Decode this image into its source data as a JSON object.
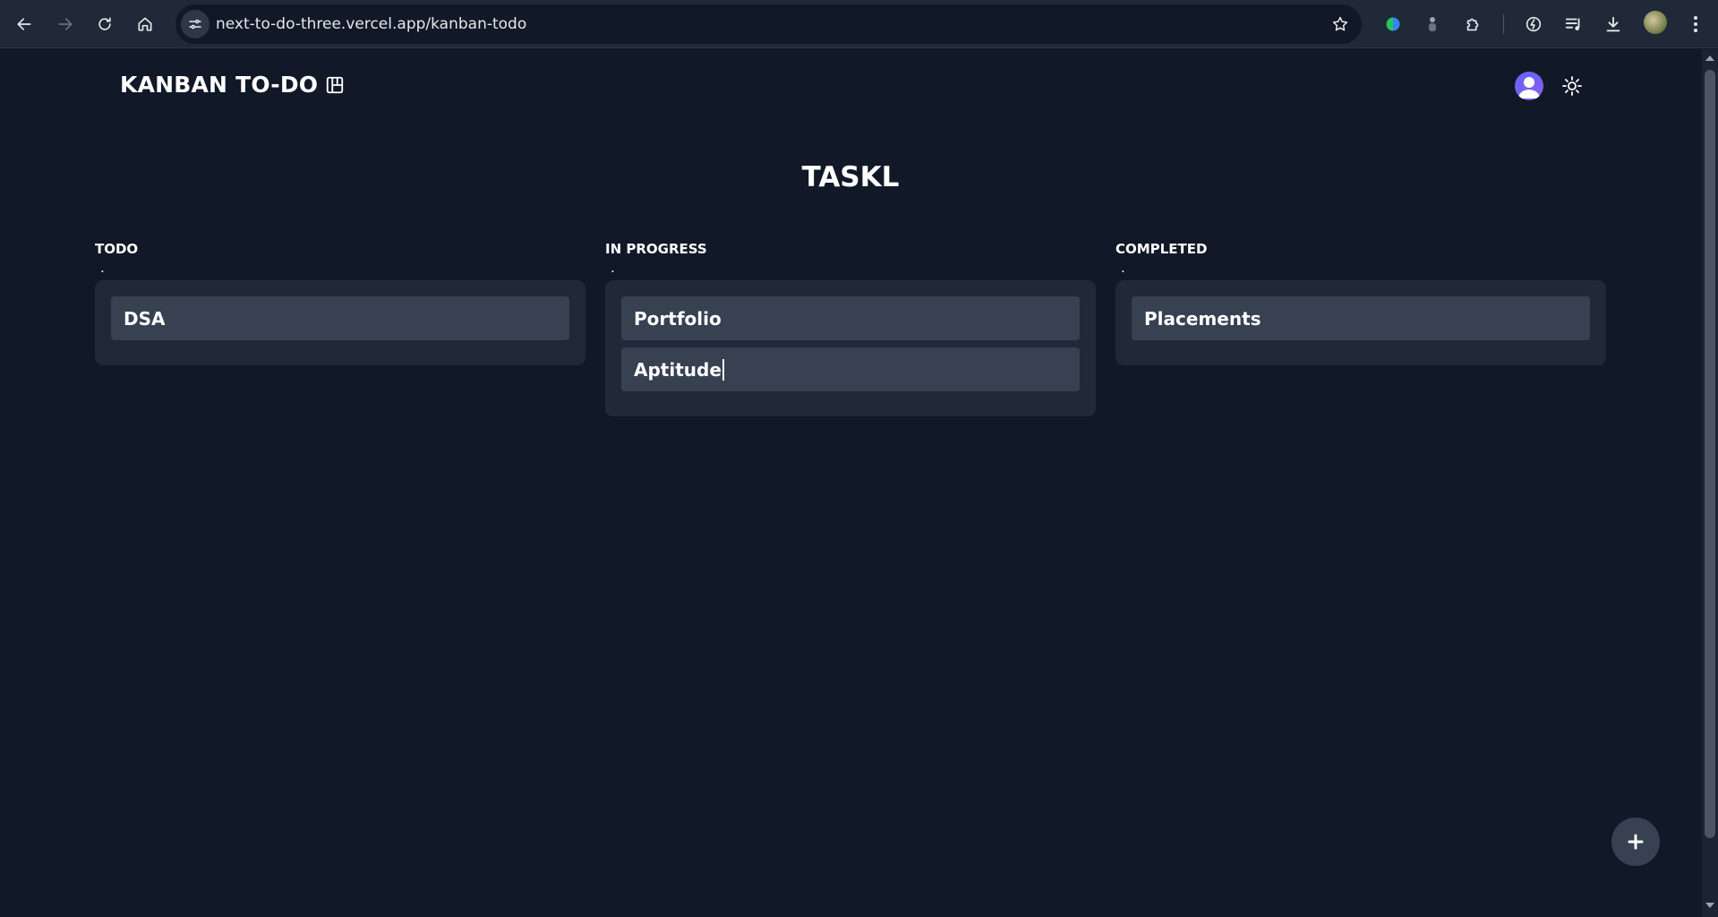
{
  "browser": {
    "url": "next-to-do-three.vercel.app/kanban-todo"
  },
  "app": {
    "title": "KANBAN TO-DO",
    "board_title": "TASKL"
  },
  "columns": [
    {
      "heading": "TODO",
      "marker": ".",
      "cards": [
        "DSA"
      ]
    },
    {
      "heading": "IN PROGRESS",
      "marker": ".",
      "cards": [
        "Portfolio",
        "Aptitude"
      ]
    },
    {
      "heading": "COMPLETED",
      "marker": ".",
      "cards": [
        "Placements"
      ]
    }
  ],
  "icons": {
    "title_icon": "kanban-board-icon",
    "theme_toggle": "sun-icon",
    "user": "user-avatar-icon",
    "add": "plus-icon"
  },
  "colors": {
    "background": "#111827",
    "column": "#1f2937",
    "card": "#374151",
    "text": "#ffffff",
    "avatar": "#6366f1"
  }
}
